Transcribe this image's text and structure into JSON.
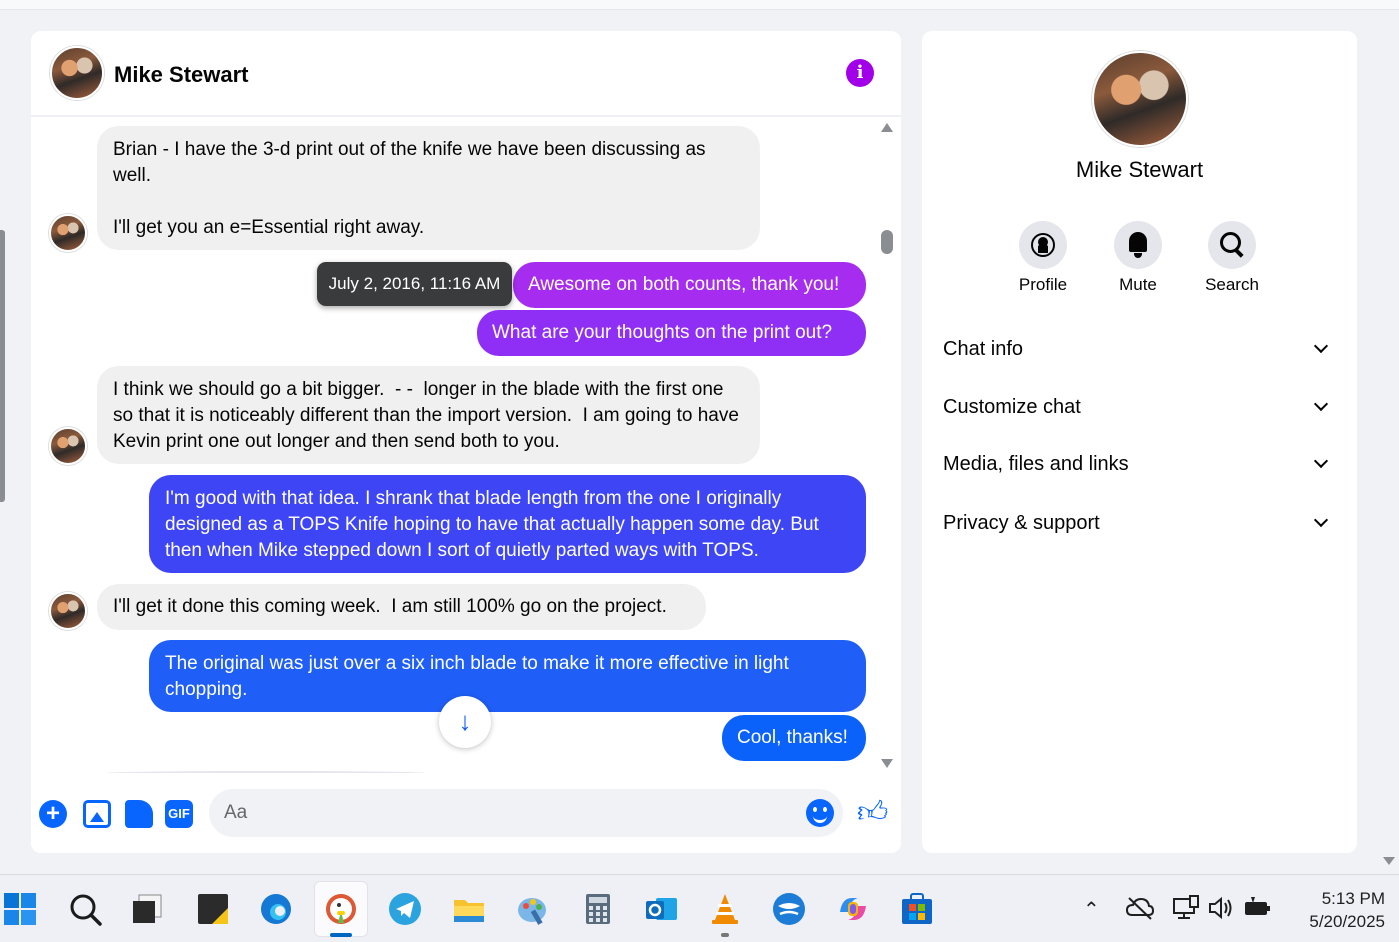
{
  "contact": {
    "name": "Mike Stewart"
  },
  "messages": [
    {
      "dir": "in",
      "text": "Brian - I have the 3-d print out of the knife we have been discussing as well.\n\nI'll get you an e=Essential right away."
    },
    {
      "dir": "out",
      "text": "Awesome on both counts, thank you!",
      "color": "#a62cf0"
    },
    {
      "dir": "out",
      "text": "What are your thoughts on the print out?",
      "color": "#8f2ff5"
    },
    {
      "dir": "in",
      "text": "I think we should go a bit bigger.  - -  longer in the blade with the first one so that it is noticeably different than the import version.  I am going to have Kevin print one out longer and then send both to you."
    },
    {
      "dir": "out",
      "text": "I'm good with that idea. I shrank that blade length from the one I originally designed as a TOPS Knife hoping to have that actually happen some day. But then when Mike stepped down I sort of quietly parted ways with TOPS.",
      "color": "#3d45f5"
    },
    {
      "dir": "in",
      "text": "I'll get it done this coming week.  I am still 100% go on the project."
    },
    {
      "dir": "out",
      "text": "The original was just over a six inch blade to make it more effective in light chopping.",
      "color": "#1f5ff8"
    },
    {
      "dir": "out",
      "text": "Cool, thanks!",
      "color": "#0a62fb"
    }
  ],
  "tooltip": "July 2, 2016, 11:16 AM",
  "composer": {
    "placeholder": "Aa",
    "icons": [
      "plus-icon",
      "photo-icon",
      "sticker-icon",
      "gif-icon",
      "emoji-icon",
      "thumbs-up-icon"
    ],
    "gif_label": "GIF"
  },
  "info_panel": {
    "name": "Mike Stewart",
    "actions": [
      {
        "label": "Profile",
        "icon": "profile-icon"
      },
      {
        "label": "Mute",
        "icon": "bell-icon"
      },
      {
        "label": "Search",
        "icon": "search-icon"
      }
    ],
    "sections": [
      "Chat info",
      "Customize chat",
      "Media, files and links",
      "Privacy & support"
    ]
  },
  "taskbar": {
    "apps": [
      "start",
      "search",
      "task-view",
      "sticky-notes",
      "edge",
      "duckduckgo",
      "telegram",
      "file-explorer",
      "paint",
      "calculator",
      "outlook",
      "vlc",
      "feedback",
      "copilot",
      "store"
    ],
    "time": "5:13 PM",
    "date": "5/20/2025"
  },
  "colors": {
    "accent": "#0866ff",
    "info_icon": "#a100e8",
    "incoming_bubble": "#f0f0f0"
  }
}
